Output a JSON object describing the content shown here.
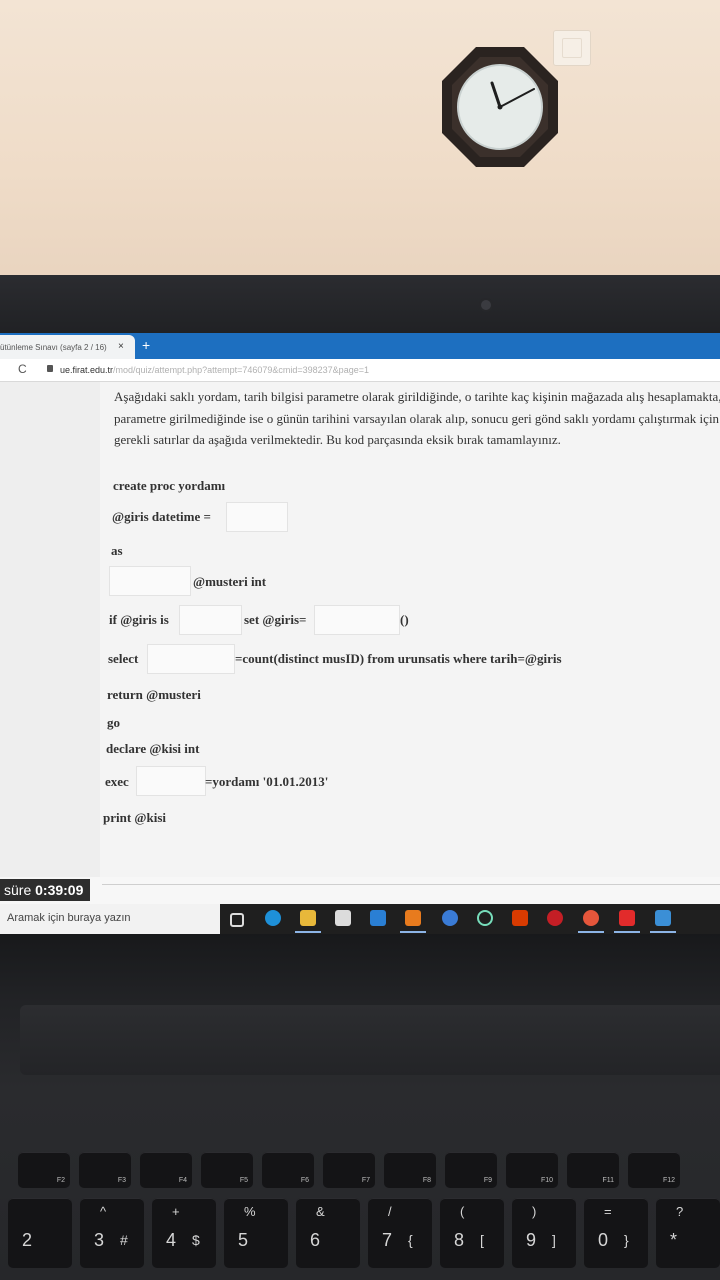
{
  "browser": {
    "tab_title": "ütünleme Sınavı (sayfa 2 / 16)",
    "tab_close": "×",
    "new_tab": "+",
    "reload": "C",
    "url_domain": "ue.firat.edu.tr",
    "url_path": "/mod/quiz/attempt.php?attempt=746079&cmid=398237&page=1"
  },
  "question": {
    "paragraph": "Aşağıdaki saklı yordam, tarih bilgisi parametre olarak girildiğinde, o tarihte kaç kişinin mağazada alış hesaplamakta, parametre girilmediğinde ise o günün tarihini varsayılan olarak alıp, sonucu geri gönd saklı yordamı çalıştırmak için gerekli satırlar da aşağıda verilmektedir. Bu kod parçasında eksik bırak tamamlayınız.",
    "lines": {
      "l1": "create proc yordamı",
      "l2": "@giris datetime =",
      "l3": "as",
      "l4": "@musteri int",
      "l5a": "if @giris is",
      "l5b": "set @giris=",
      "l5c": "()",
      "l6a": "select",
      "l6b": "=count(distinct musID) from urunsatis where tarih=@giris",
      "l7": "return @musteri",
      "l8": "go",
      "l9": "declare @kisi int",
      "l10a": "exec",
      "l10b": "=yordamı '01.01.2013'",
      "l11": "print @kisi"
    }
  },
  "timer": {
    "label": "süre",
    "value": "0:39:09"
  },
  "taskbar": {
    "search_placeholder": "Aramak için buraya yazın",
    "icons": [
      "task-view-icon",
      "edge-icon",
      "file-explorer-icon",
      "store-icon",
      "mail-icon",
      "app-9-icon",
      "ccleaner-icon",
      "app-u-icon",
      "office-icon",
      "opera-icon",
      "paint-icon",
      "acrobat-icon",
      "photos-icon"
    ]
  },
  "keyboard": {
    "fn_row": [
      "F2",
      "F3",
      "F4",
      "F5",
      "F6",
      "F7",
      "F8",
      "F9",
      "F10",
      "F11",
      "F12"
    ],
    "number_row": [
      {
        "top": "",
        "main": "2",
        "alt": ""
      },
      {
        "top": "^",
        "main": "3",
        "alt": "#"
      },
      {
        "top": "+",
        "main": "4",
        "alt": "$"
      },
      {
        "top": "%",
        "main": "5",
        "alt": ""
      },
      {
        "top": "&",
        "main": "6",
        "alt": ""
      },
      {
        "top": "/",
        "main": "7",
        "alt": "{"
      },
      {
        "top": "(",
        "main": "8",
        "alt": "["
      },
      {
        "top": ")",
        "main": "9",
        "alt": "]"
      },
      {
        "top": "=",
        "main": "0",
        "alt": "}"
      },
      {
        "top": "?",
        "main": "*",
        "alt": ""
      }
    ]
  },
  "colors": {
    "wall": "#efdcc8",
    "tabbar": "#1d6fc0",
    "page": "#f4f4f4",
    "taskbar": "#1f1f1f"
  }
}
